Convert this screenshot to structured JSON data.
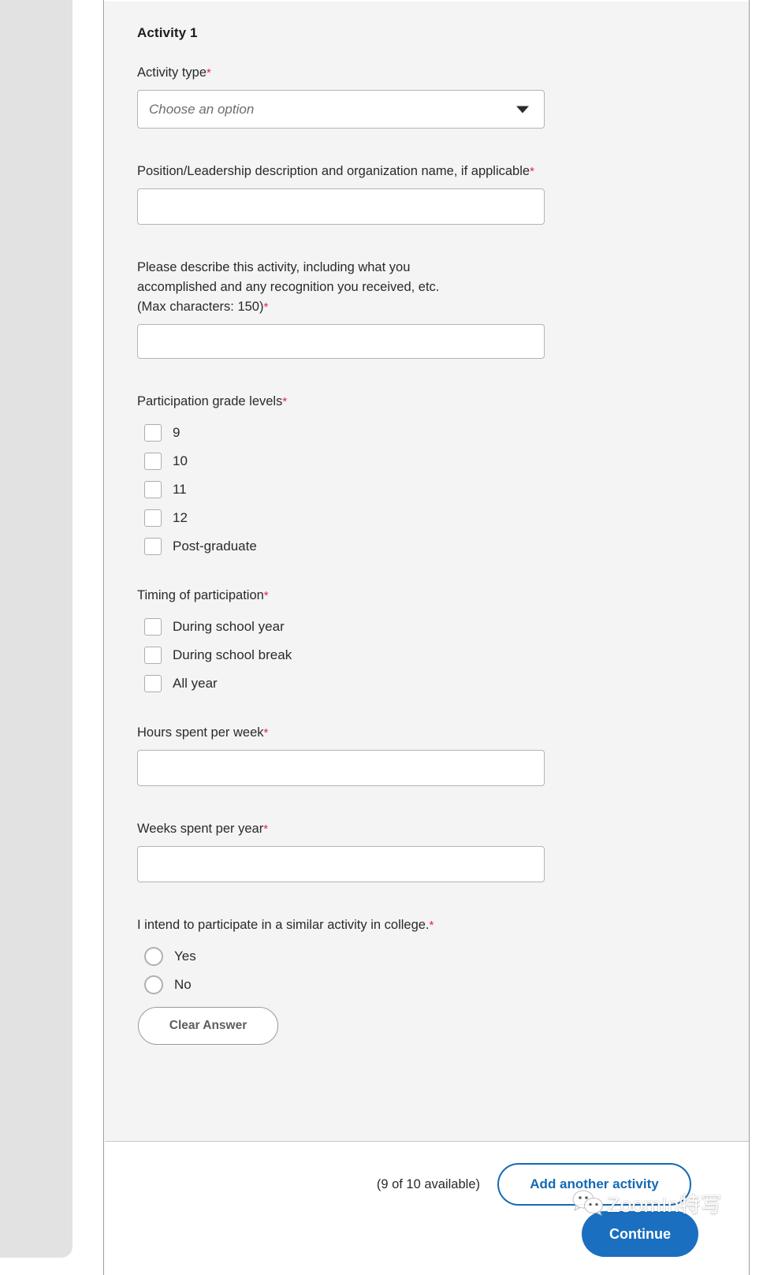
{
  "card": {
    "title": "Activity 1"
  },
  "fields": {
    "activity_type": {
      "label": "Activity type",
      "required_mark": "*",
      "placeholder": "Choose an option",
      "caret_icon": "chevron-down-icon"
    },
    "position": {
      "label": "Position/Leadership description and organization name, if applicable",
      "required_mark": "*",
      "value": "",
      "placeholder": ""
    },
    "description": {
      "label": "Please describe this activity, including what you accomplished and any recognition you received, etc. (Max characters: 150)",
      "label_line1": "Please describe this activity, including what you",
      "label_line2": "accomplished and any recognition you received, etc.",
      "label_line3": "(Max characters: 150)",
      "required_mark": "*",
      "value": "",
      "placeholder": ""
    },
    "hours": {
      "label": "Hours spent per week",
      "required_mark": "*",
      "value": "",
      "placeholder": ""
    },
    "weeks": {
      "label": "Weeks spent per year",
      "required_mark": "*",
      "value": "",
      "placeholder": ""
    }
  },
  "grade_levels": {
    "label": "Participation grade levels",
    "required_mark": "*",
    "options": [
      {
        "label": "9",
        "checked": false
      },
      {
        "label": "10",
        "checked": false
      },
      {
        "label": "11",
        "checked": false
      },
      {
        "label": "12",
        "checked": false
      },
      {
        "label": "Post-graduate",
        "checked": false
      }
    ]
  },
  "timing": {
    "label": "Timing of participation",
    "required_mark": "*",
    "options": [
      {
        "label": "During school year",
        "checked": false
      },
      {
        "label": "During school break",
        "checked": false
      },
      {
        "label": "All year",
        "checked": false
      }
    ]
  },
  "intend": {
    "label": "I intend to participate in a similar activity in college.",
    "required_mark": "*",
    "options": [
      {
        "label": "Yes",
        "selected": false
      },
      {
        "label": "No",
        "selected": false
      }
    ],
    "clear_label": "Clear Answer"
  },
  "actions": {
    "availability": "(9 of 10 available)",
    "add_activity": "Add another activity",
    "continue": "Continue"
  },
  "watermark": {
    "text": "ZoomIn特写",
    "logo_icon": "wechat-icon"
  },
  "colors": {
    "required": "#e0234c",
    "link_blue": "#1469b5",
    "button_blue": "#1b6fc0",
    "card_bg": "#f4f4f4",
    "rail_bg": "#e2e2e2"
  }
}
